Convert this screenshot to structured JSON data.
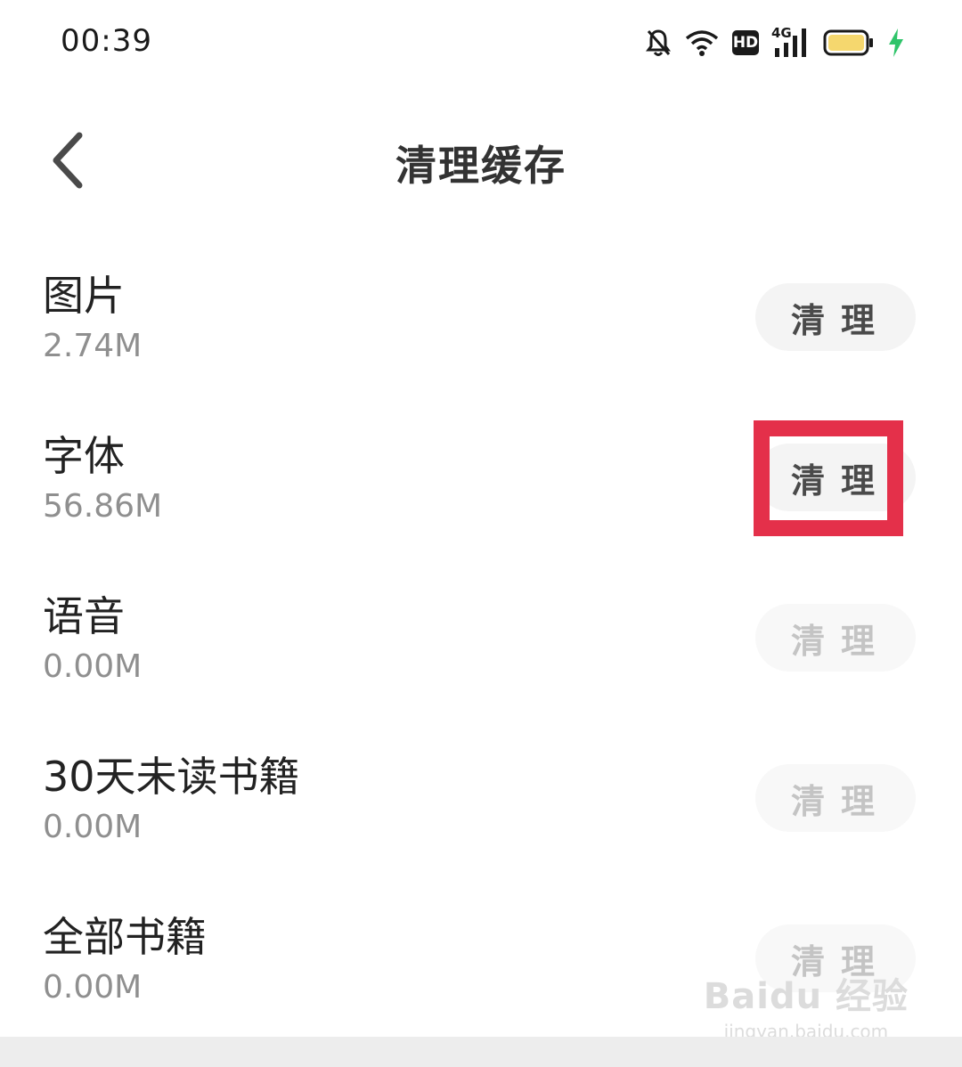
{
  "status_bar": {
    "time": "00:39",
    "hd_badge": "HD",
    "network": "4G",
    "icons": [
      "bell-off-icon",
      "wifi-icon",
      "hd-icon",
      "signal-4g-icon",
      "battery-icon",
      "charging-bolt-icon"
    ],
    "battery_color": "#f5d76e",
    "bolt_color": "#2fc46a"
  },
  "header": {
    "back_icon": "chevron-left-icon",
    "title": "清理缓存"
  },
  "items": [
    {
      "name": "图片",
      "size": "2.74M",
      "button": "清理",
      "enabled": true
    },
    {
      "name": "字体",
      "size": "56.86M",
      "button": "清理",
      "enabled": true
    },
    {
      "name": "语音",
      "size": "0.00M",
      "button": "清理",
      "enabled": false
    },
    {
      "name": "30天未读书籍",
      "size": "0.00M",
      "button": "清理",
      "enabled": false
    },
    {
      "name": "全部书籍",
      "size": "0.00M",
      "button": "清理",
      "enabled": false
    }
  ],
  "highlight_color": "#e4304a",
  "watermark": {
    "logo": "Baidu 经验",
    "url": "jingyan.baidu.com"
  }
}
